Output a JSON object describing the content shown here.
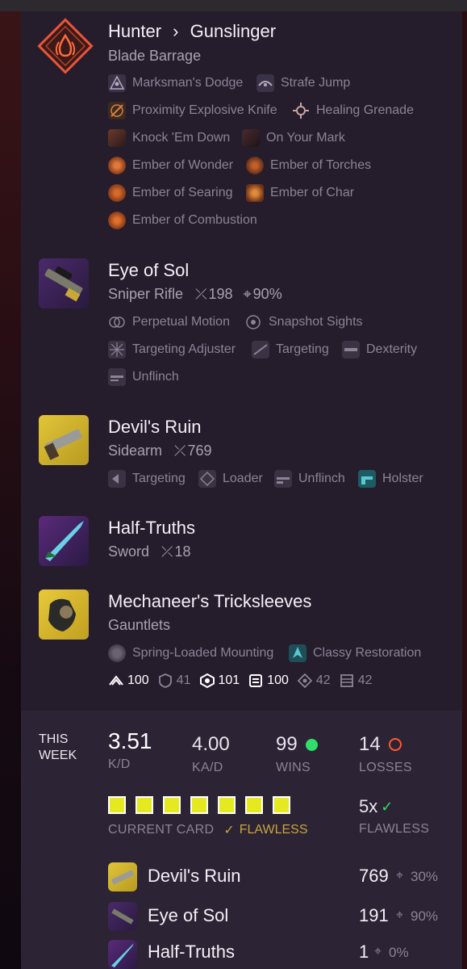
{
  "subclass": {
    "class_name": "Hunter",
    "separator": "›",
    "subclass_name": "Gunslinger",
    "super": "Blade Barrage",
    "abilities": [
      {
        "label": "Marksman's Dodge",
        "icon": "dodge-icon"
      },
      {
        "label": "Strafe Jump",
        "icon": "jump-icon"
      },
      {
        "label": "Proximity Explosive Knife",
        "icon": "knife-icon"
      },
      {
        "label": "Healing Grenade",
        "icon": "grenade-icon"
      },
      {
        "label": "Knock 'Em Down",
        "icon": "aspect-icon"
      },
      {
        "label": "On Your Mark",
        "icon": "aspect-icon"
      },
      {
        "label": "Ember of Wonder",
        "icon": "ember-icon"
      },
      {
        "label": "Ember of Torches",
        "icon": "ember-icon"
      },
      {
        "label": "Ember of Searing",
        "icon": "ember-icon"
      },
      {
        "label": "Ember of Char",
        "icon": "ember-icon"
      },
      {
        "label": "Ember of Combustion",
        "icon": "ember-icon"
      }
    ]
  },
  "weapons": [
    {
      "name": "Eye of Sol",
      "type": "Sniper Rifle",
      "kills": "198",
      "precision": "90%",
      "perks": [
        "Perpetual Motion",
        "Snapshot Sights",
        "Targeting Adjuster",
        "Targeting",
        "Dexterity",
        "Unflinch"
      ]
    },
    {
      "name": "Devil's Ruin",
      "type": "Sidearm",
      "kills": "769",
      "perks": [
        "Targeting",
        "Loader",
        "Unflinch",
        "Holster"
      ]
    },
    {
      "name": "Half-Truths",
      "type": "Sword",
      "kills": "18"
    }
  ],
  "armor": {
    "name": "Mechaneer's Tricksleeves",
    "type": "Gauntlets",
    "perks": [
      "Spring-Loaded Mounting",
      "Classy Restoration"
    ],
    "stats": [
      {
        "icon": "mobility-icon",
        "value": "100"
      },
      {
        "icon": "resilience-icon",
        "value": "41"
      },
      {
        "icon": "recovery-icon",
        "value": "101"
      },
      {
        "icon": "discipline-icon",
        "value": "100"
      },
      {
        "icon": "intellect-icon",
        "value": "42"
      },
      {
        "icon": "strength-icon",
        "value": "42"
      }
    ]
  },
  "week": {
    "label_line1": "THIS",
    "label_line2": "WEEK",
    "kd": "3.51",
    "kd_label": "K/D",
    "kad": "4.00",
    "kad_label": "KA/D",
    "wins": "99",
    "wins_label": "WINS",
    "losses": "14",
    "losses_label": "LOSSES",
    "card_label": "CURRENT CARD",
    "card_flawless": "FLAWLESS",
    "card_wins_filled": 7,
    "flawless_count": "5x",
    "flawless_label": "FLAWLESS",
    "colors": {
      "win": "#2ee06a",
      "loss": "#ff5a2a",
      "gold": "#c9a43e",
      "card": "#e4ea1f"
    }
  },
  "weekly_weapons": [
    {
      "name": "Devil's Ruin",
      "kills": "769",
      "precision": "30%"
    },
    {
      "name": "Eye of Sol",
      "kills": "191",
      "precision": "90%"
    },
    {
      "name": "Half-Truths",
      "kills": "1",
      "precision": "0%"
    }
  ]
}
